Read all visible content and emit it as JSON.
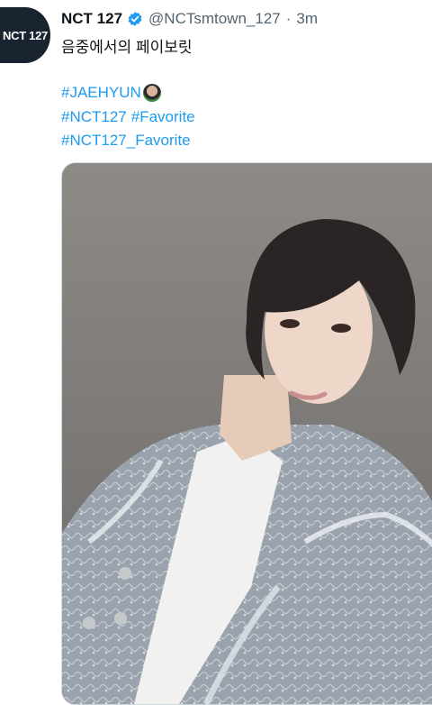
{
  "tweet": {
    "display_name": "NCT 127",
    "avatar_text": "NCT 127",
    "handle": "@NCTsmtown_127",
    "separator": "·",
    "time": "3m",
    "text": "음중에서의 페이보릿",
    "hashtags": [
      [
        "#JAEHYUN"
      ],
      [
        "#NCT127",
        "#Favorite"
      ],
      [
        "#NCT127_Favorite"
      ]
    ]
  },
  "colors": {
    "link": "#1d9bf0",
    "verified": "#1d9bf0",
    "muted": "#536471"
  },
  "icons": {
    "verified": "verified-badge-icon",
    "emoji": "jaehyun-hashflag-icon"
  }
}
